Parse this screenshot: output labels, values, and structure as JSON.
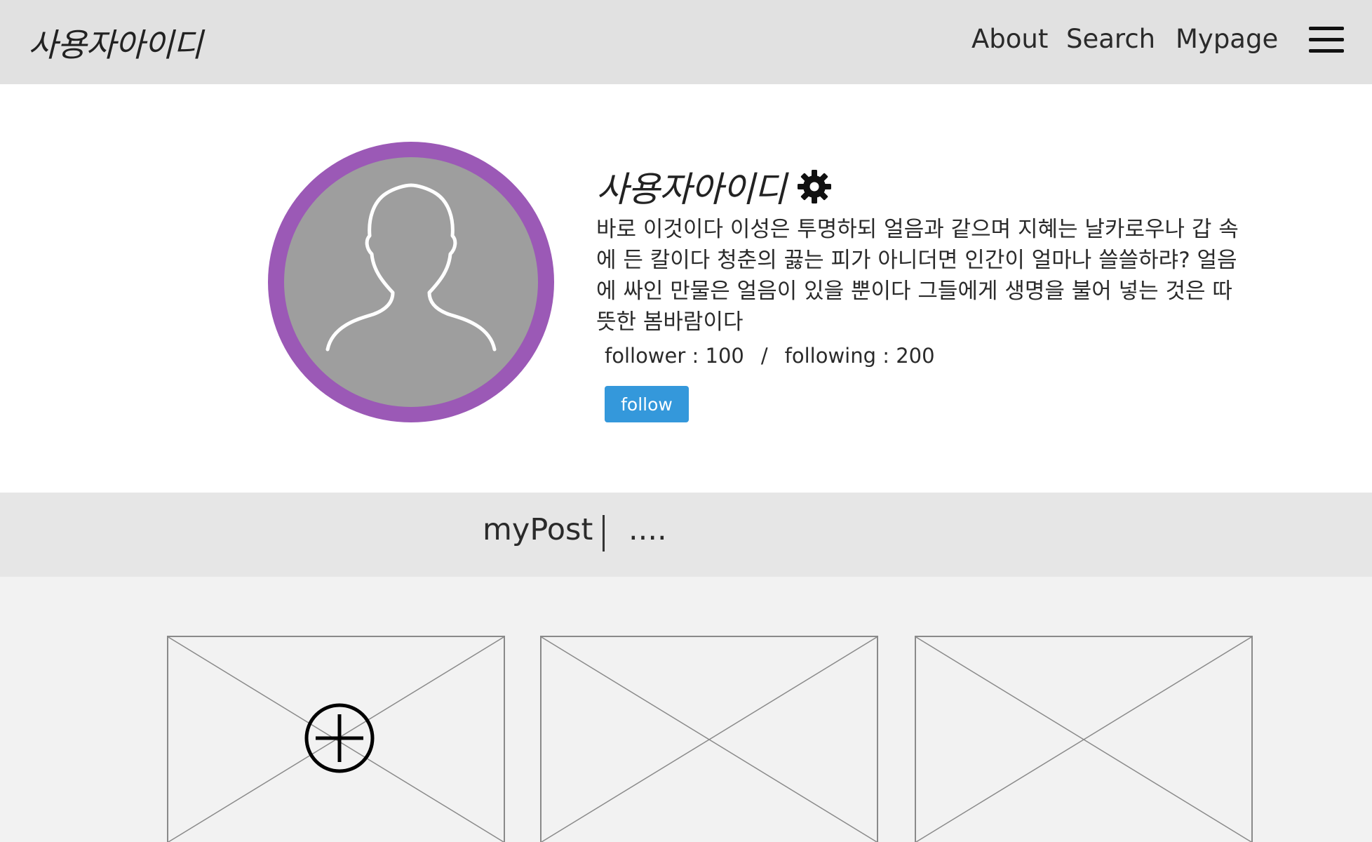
{
  "header": {
    "brand": "사용자아이디",
    "nav": {
      "about": "About",
      "search": "Search",
      "mypage": "Mypage"
    },
    "menu_icon": "hamburger-menu-icon"
  },
  "profile": {
    "username": "사용자아이디",
    "settings_icon": "gear-icon",
    "avatar_icon": "user-silhouette-icon",
    "bio_lines": [
      "바로 이것이다 이성은 투명하되 얼음과 같으며 지혜는 날카로우나 갑 속",
      "에 든 칼이다 청춘의 끓는 피가 아니더면 인간이 얼마나 쓸쓸하랴? 얼음",
      "에 싸인 만물은 얼음이 있을 뿐이다 그들에게 생명을 불어 넣는 것은 따",
      "뜻한 봄바람이다"
    ],
    "follower": "follower : 100",
    "separator": "/",
    "following": "following : 200",
    "follow_button": "follow"
  },
  "tabs": {
    "mypost": "myPost",
    "more": "...."
  },
  "posts": {
    "add_icon": "add-circle-icon",
    "placeholder_icon": "image-placeholder-icon"
  },
  "colors": {
    "header_bg": "#e1e1e1",
    "avatar_ring": "#9b59b6",
    "avatar_fill": "#9e9e9e",
    "follow_button": "#3498db",
    "tabbar_bg": "#e6e6e6",
    "content_bg": "#f2f2f2"
  }
}
